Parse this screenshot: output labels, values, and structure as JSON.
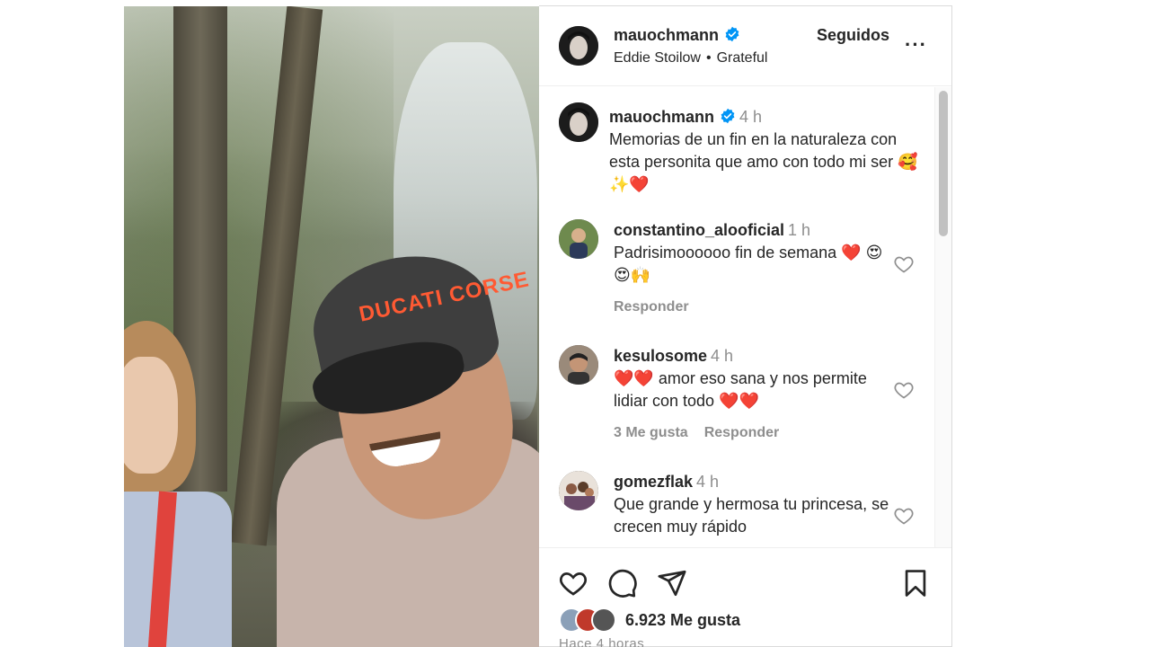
{
  "post": {
    "media_alt": "",
    "cap_text": "DUCATI CORSE"
  },
  "header": {
    "username": "mauochmann",
    "song_artist": "Eddie Stoilow",
    "song_title": "Grateful",
    "song_separator": "•",
    "follow_label": "Seguidos",
    "more_label": "···"
  },
  "caption": {
    "username": "mauochmann",
    "time": "4 h",
    "text": "Memorias de un fin en la naturaleza con esta personita que amo con todo mi ser 🥰✨❤️"
  },
  "comments": [
    {
      "username": "constantino_alooficial",
      "time": "1 h",
      "text": "Padrisimoooooo fin de semana ❤️ 😍😍🙌",
      "likes": "",
      "reply_label": "Responder"
    },
    {
      "username": "kesulosome",
      "time": "4 h",
      "text": "❤️❤️ amor eso sana y nos permite lidiar con todo ❤️❤️",
      "likes": "3 Me gusta",
      "reply_label": "Responder"
    },
    {
      "username": "gomezflak",
      "time": "4 h",
      "text": "Que grande y hermosa tu princesa, se crecen muy rápido",
      "likes": "",
      "reply_label": ""
    }
  ],
  "footer": {
    "likes_count": "6.923 Me gusta",
    "posted_ago": "Hace 4 horas"
  },
  "colors": {
    "verified": "#0095f6",
    "text": "#262626",
    "muted": "#8e8e8e"
  },
  "icons": [
    "heart-icon",
    "comment-icon",
    "share-icon",
    "bookmark-icon",
    "verified-badge-icon",
    "more-options-icon"
  ]
}
